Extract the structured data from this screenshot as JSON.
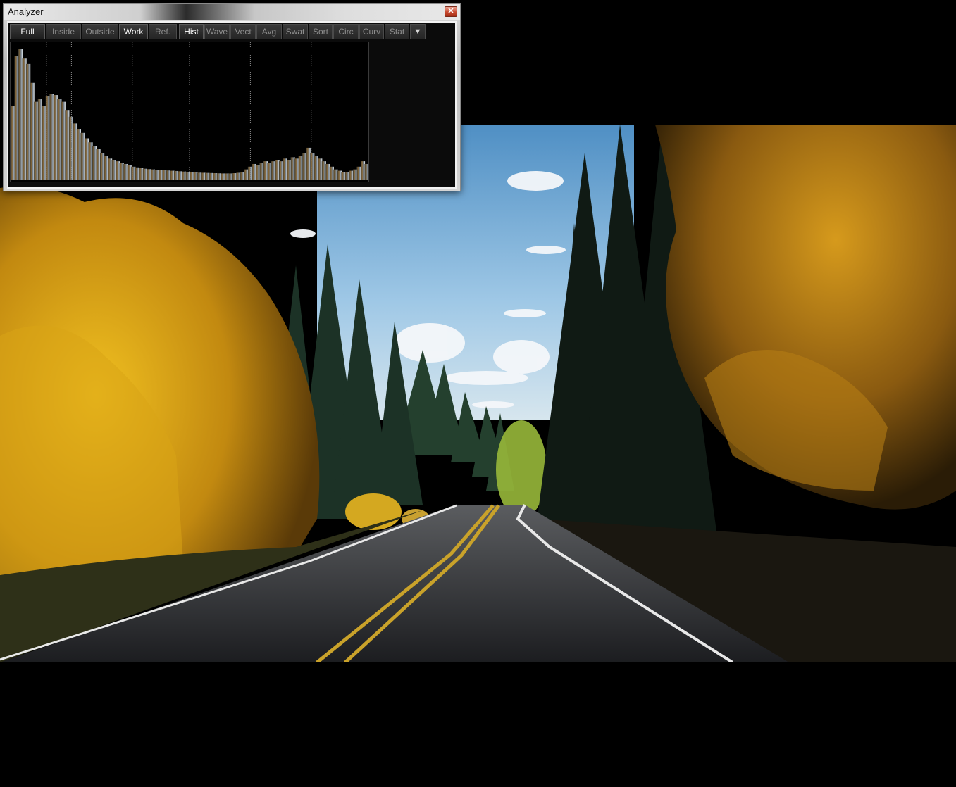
{
  "window": {
    "title": "Analyzer",
    "close_glyph": "✕"
  },
  "toolbar": {
    "scope_buttons": [
      {
        "label": "Full",
        "active": true
      },
      {
        "label": "Inside",
        "active": false
      },
      {
        "label": "Outside",
        "active": false
      },
      {
        "label": "Work",
        "active": true
      },
      {
        "label": "Ref.",
        "active": false
      }
    ],
    "view_buttons": [
      {
        "label": "Hist",
        "active": true
      },
      {
        "label": "Wave",
        "active": false
      },
      {
        "label": "Vect",
        "active": false
      },
      {
        "label": "Avg",
        "active": false
      },
      {
        "label": "Swat",
        "active": false
      },
      {
        "label": "Sort",
        "active": false
      },
      {
        "label": "Circ",
        "active": false
      },
      {
        "label": "Curv",
        "active": false
      },
      {
        "label": "Stat",
        "active": false
      }
    ],
    "dropdown_glyph": "▼"
  },
  "histogram": {
    "bins": [
      0.55,
      0.92,
      0.97,
      0.9,
      0.86,
      0.72,
      0.58,
      0.6,
      0.55,
      0.62,
      0.64,
      0.63,
      0.6,
      0.58,
      0.52,
      0.47,
      0.42,
      0.38,
      0.35,
      0.31,
      0.28,
      0.25,
      0.23,
      0.2,
      0.18,
      0.16,
      0.15,
      0.14,
      0.13,
      0.12,
      0.11,
      0.1,
      0.095,
      0.09,
      0.085,
      0.082,
      0.08,
      0.078,
      0.076,
      0.074,
      0.072,
      0.07,
      0.068,
      0.066,
      0.064,
      0.062,
      0.06,
      0.058,
      0.056,
      0.055,
      0.054,
      0.053,
      0.052,
      0.051,
      0.05,
      0.05,
      0.05,
      0.052,
      0.055,
      0.06,
      0.08,
      0.1,
      0.12,
      0.11,
      0.13,
      0.14,
      0.13,
      0.14,
      0.15,
      0.14,
      0.16,
      0.15,
      0.17,
      0.16,
      0.18,
      0.2,
      0.24,
      0.2,
      0.18,
      0.16,
      0.14,
      0.12,
      0.1,
      0.08,
      0.07,
      0.06,
      0.06,
      0.07,
      0.08,
      0.1,
      0.14,
      0.12
    ],
    "guide_positions": [
      0.1,
      0.17,
      0.34,
      0.5,
      0.67,
      0.84
    ],
    "dark_color": "#3a3a32",
    "mid_color": "#8a6a3a",
    "light_color": "#e8eef2"
  },
  "colors": {
    "sky": "#7fb4dc",
    "foliage_yellow": "#d9a416",
    "conifer": "#1f3326",
    "road": "#242629",
    "center_line": "#c9a22a",
    "edge_line": "#e8e8e8"
  }
}
